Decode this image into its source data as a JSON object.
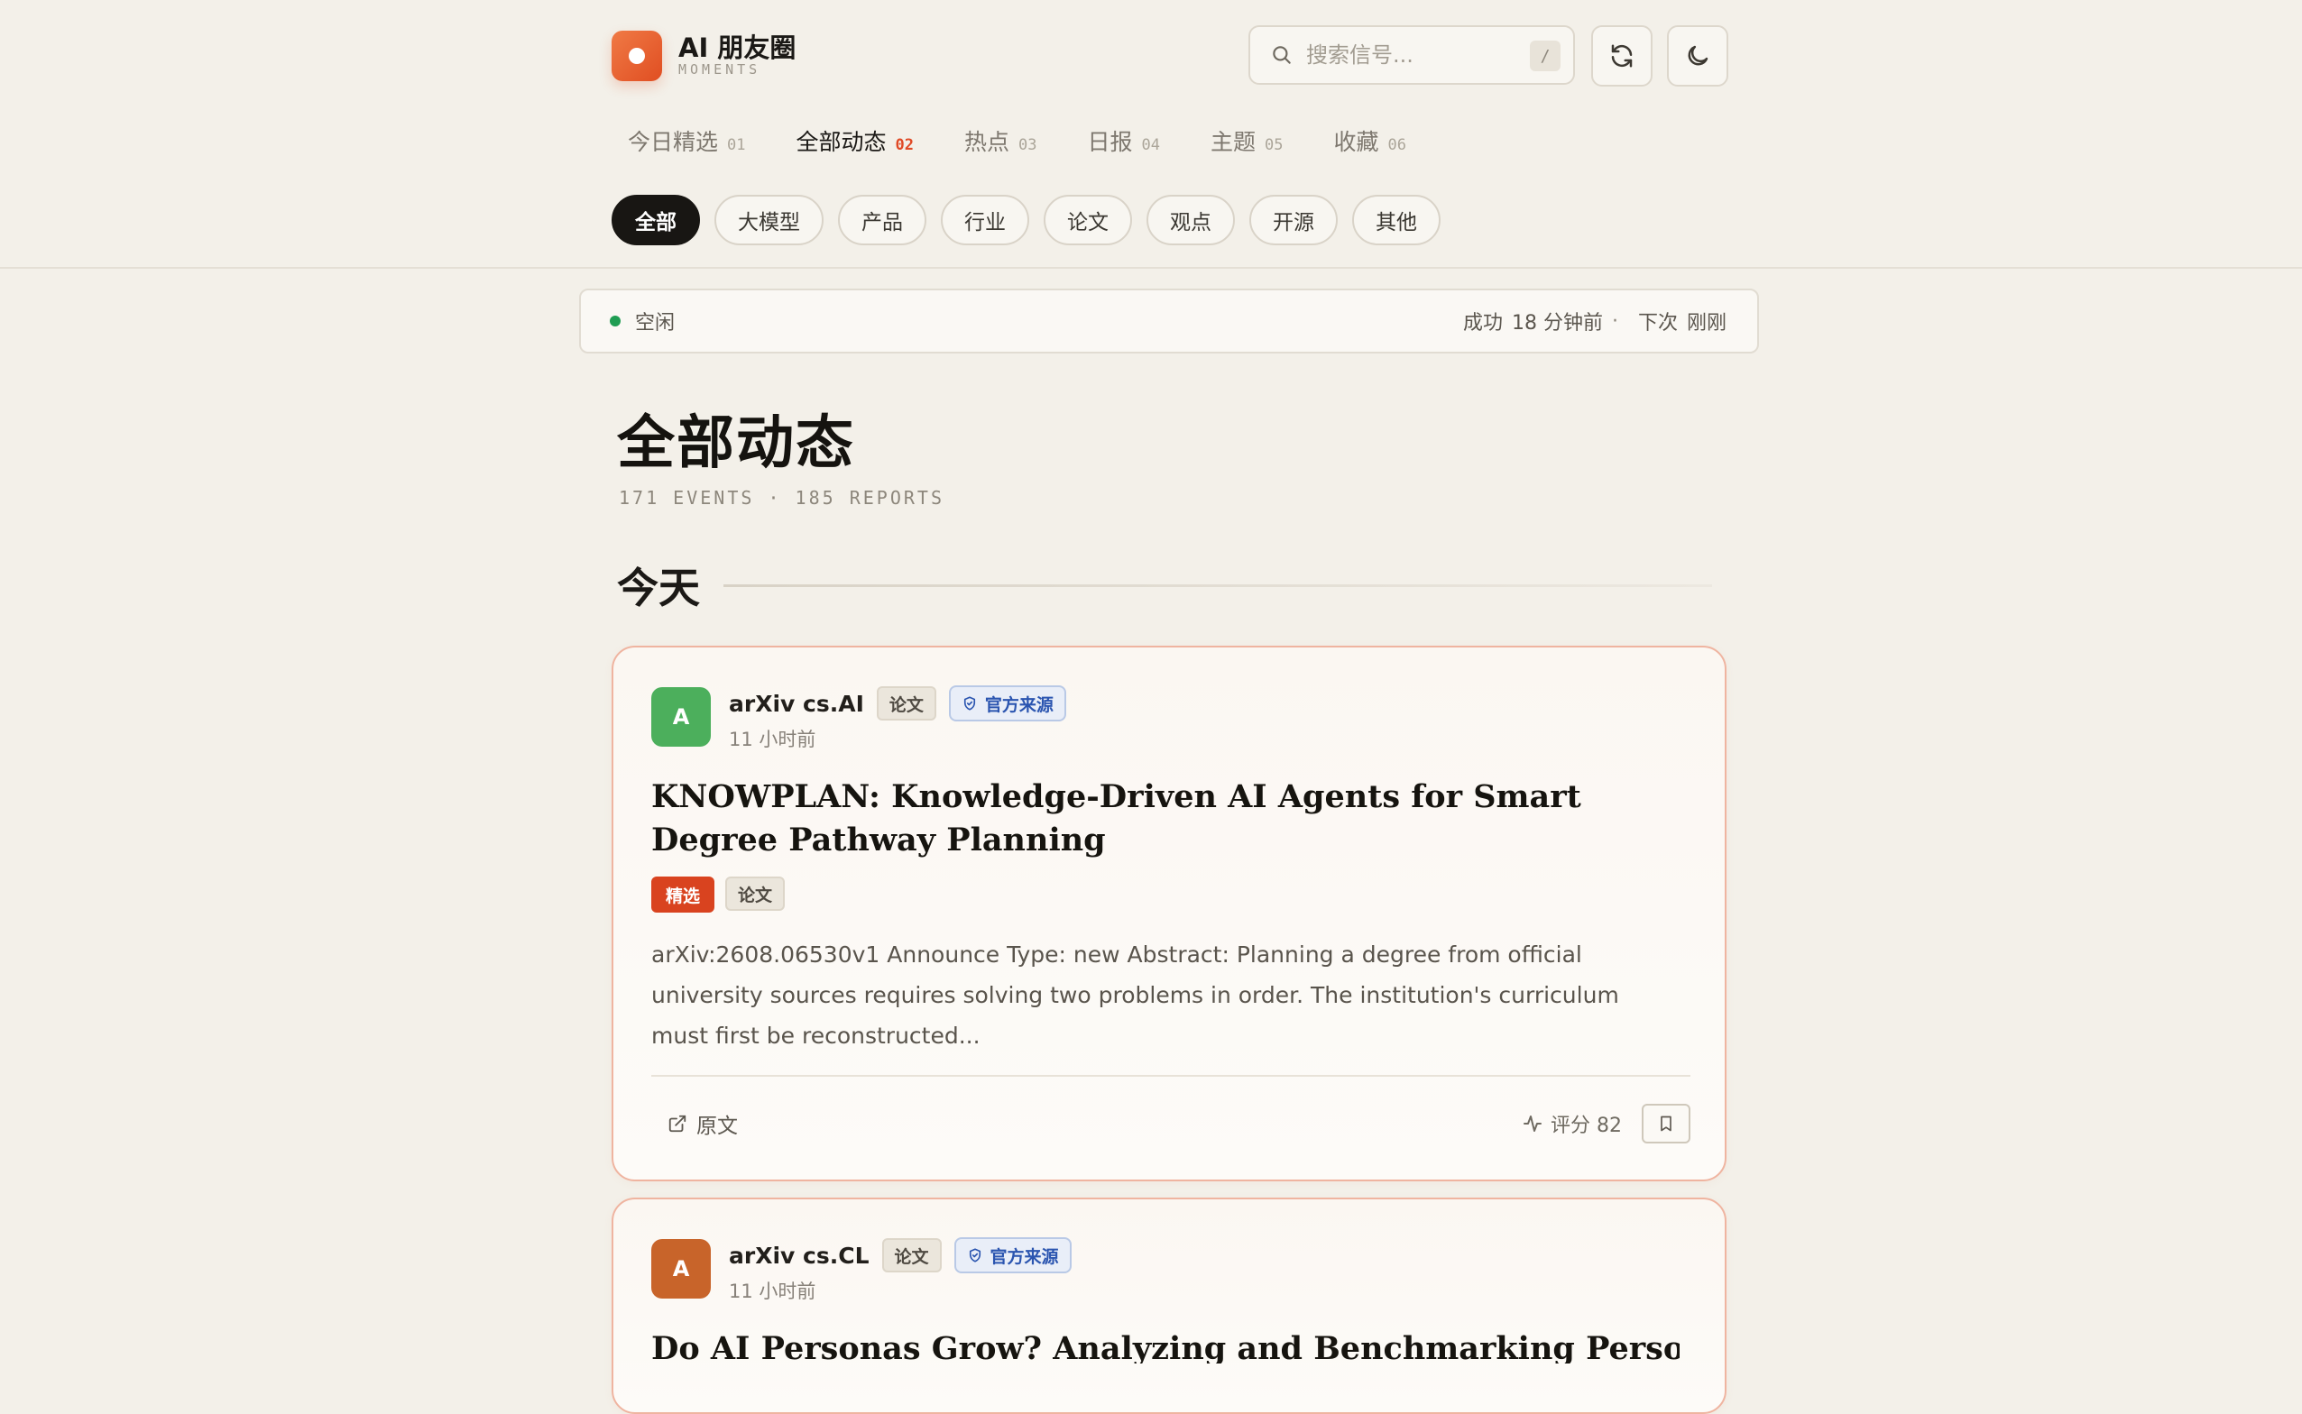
{
  "brand": {
    "title": "AI 朋友圈",
    "subtitle": "MOMENTS"
  },
  "search": {
    "placeholder": "搜索信号...",
    "shortcut": "/"
  },
  "header_buttons": {
    "refresh_icon": "refresh-icon",
    "theme_icon": "moon-icon"
  },
  "nav": [
    {
      "label": "今日精选",
      "num": "01",
      "active": false
    },
    {
      "label": "全部动态",
      "num": "02",
      "active": true
    },
    {
      "label": "热点",
      "num": "03",
      "active": false
    },
    {
      "label": "日报",
      "num": "04",
      "active": false
    },
    {
      "label": "主题",
      "num": "05",
      "active": false
    },
    {
      "label": "收藏",
      "num": "06",
      "active": false
    }
  ],
  "chips": [
    {
      "label": "全部",
      "active": true
    },
    {
      "label": "大模型",
      "active": false
    },
    {
      "label": "产品",
      "active": false
    },
    {
      "label": "行业",
      "active": false
    },
    {
      "label": "论文",
      "active": false
    },
    {
      "label": "观点",
      "active": false
    },
    {
      "label": "开源",
      "active": false
    },
    {
      "label": "其他",
      "active": false
    }
  ],
  "status": {
    "state": "空闲",
    "success_label": "成功",
    "success_value": "18 分钟前",
    "separator": "·",
    "next_label": "下次",
    "next_value": "刚刚",
    "dot_color": "#1f9d52"
  },
  "page": {
    "title": "全部动态",
    "stats": "171 EVENTS · 185 REPORTS",
    "day_label": "今天"
  },
  "cards": [
    {
      "avatar_letter": "A",
      "avatar_color": "#4caf5c",
      "source": "arXiv cs.AI",
      "category_tag": "论文",
      "official_tag": "官方来源",
      "time": "11 小时前",
      "title": "KNOWPLAN: Knowledge-Driven AI Agents for Smart Degree Pathway Planning",
      "badge_featured": "精选",
      "badge_type": "论文",
      "abstract": "arXiv:2608.06530v1 Announce Type: new Abstract: Planning a degree from official university sources requires solving two problems in order. The institution's curriculum must first be reconstructed...",
      "source_link": "原文",
      "score_label": "评分 82"
    },
    {
      "avatar_letter": "A",
      "avatar_color": "#c8642a",
      "source": "arXiv cs.CL",
      "category_tag": "论文",
      "official_tag": "官方来源",
      "time": "11 小时前",
      "title": "Do AI Personas Grow? Analyzing and Benchmarking Personality Evolution"
    }
  ],
  "colors": {
    "accent": "#e04a26",
    "card_border": "#efb4a0",
    "background": "#f3f0e9"
  }
}
